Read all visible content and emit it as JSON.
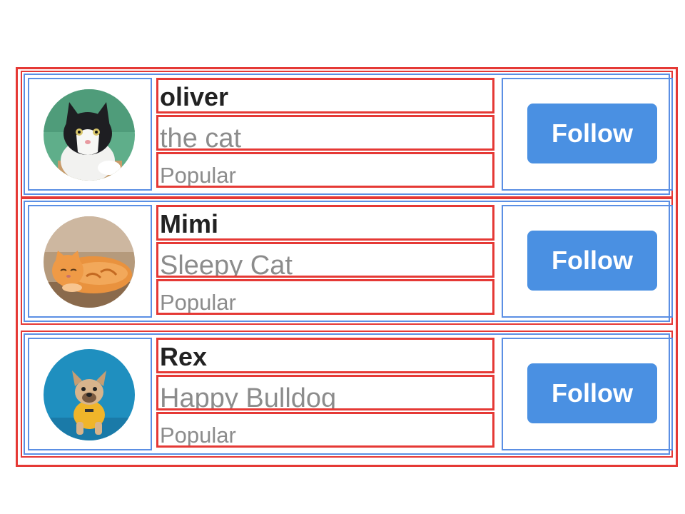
{
  "colors": {
    "accent": "#4a90e2",
    "outline_red": "#e53935",
    "outline_blue": "#5b8fe4",
    "name_text": "#222222",
    "secondary_text": "#8c8c8c"
  },
  "users": [
    {
      "name": "oliver",
      "subtitle": "the cat",
      "tag": "Popular",
      "follow_label": "Follow",
      "avatar_icon": "cat-black-white-avatar"
    },
    {
      "name": "Mimi",
      "subtitle": "Sleepy Cat",
      "tag": "Popular",
      "follow_label": "Follow",
      "avatar_icon": "orange-cat-avatar"
    },
    {
      "name": "Rex",
      "subtitle": "Happy Bulldog",
      "tag": "Popular",
      "follow_label": "Follow",
      "avatar_icon": "bulldog-avatar"
    }
  ]
}
